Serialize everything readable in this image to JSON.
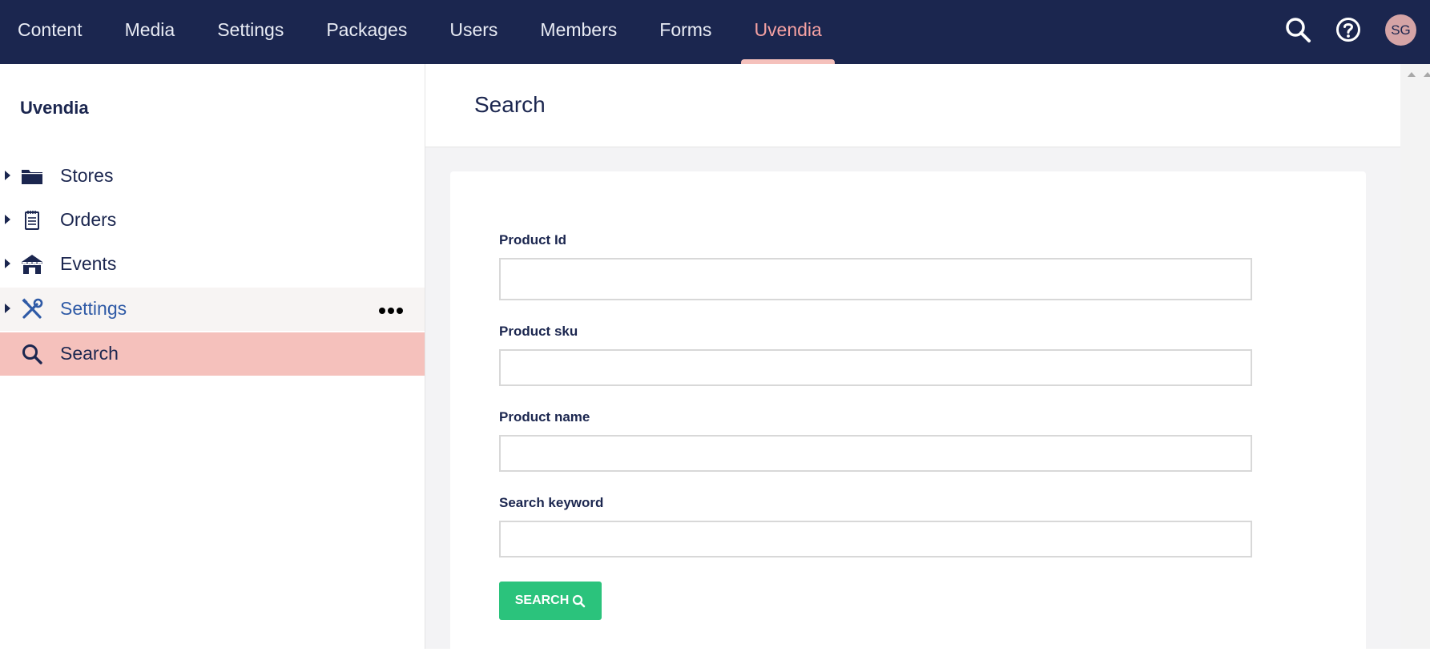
{
  "topnav": {
    "items": [
      {
        "label": "Content"
      },
      {
        "label": "Media"
      },
      {
        "label": "Settings"
      },
      {
        "label": "Packages"
      },
      {
        "label": "Users"
      },
      {
        "label": "Members"
      },
      {
        "label": "Forms"
      },
      {
        "label": "Uvendia",
        "active": true
      }
    ],
    "search_icon": "search-icon",
    "help_icon": "help-icon",
    "avatar_initials": "SG"
  },
  "sidebar": {
    "title": "Uvendia",
    "items": [
      {
        "label": "Stores",
        "icon": "folder-icon"
      },
      {
        "label": "Orders",
        "icon": "receipt-icon"
      },
      {
        "label": "Events",
        "icon": "store-icon"
      },
      {
        "label": "Settings",
        "icon": "tools-icon"
      },
      {
        "label": "Search",
        "icon": "search-icon",
        "selected": true
      }
    ]
  },
  "main": {
    "title": "Search",
    "form": {
      "product_id_label": "Product Id",
      "product_id_value": "",
      "product_sku_label": "Product sku",
      "product_sku_value": "",
      "product_name_label": "Product name",
      "product_name_value": "",
      "keyword_label": "Search keyword",
      "keyword_value": "",
      "search_button_label": "SEARCH"
    }
  },
  "colors": {
    "topbar": "#1b264f",
    "active_nav": "#f5a1a2",
    "selected_item": "#f5c1bc",
    "button": "#2bc37c"
  }
}
